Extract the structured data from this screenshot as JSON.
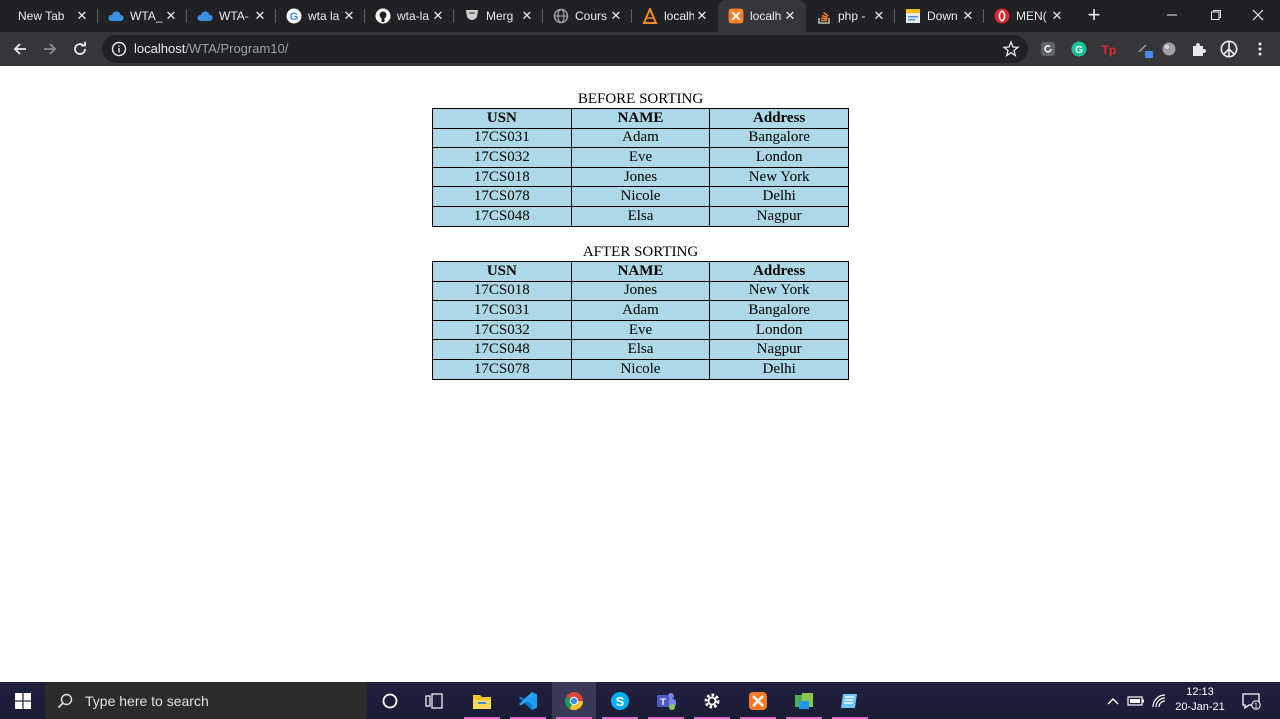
{
  "browser": {
    "tabs": [
      {
        "title": "New Tab",
        "icon": "none"
      },
      {
        "title": "WTA_",
        "icon": "onedrive-icon"
      },
      {
        "title": "WTA-",
        "icon": "onedrive-icon"
      },
      {
        "title": "wta la",
        "icon": "google-icon"
      },
      {
        "title": "wta-la",
        "icon": "github-icon"
      },
      {
        "title": "Merg",
        "icon": "merge-icon"
      },
      {
        "title": "Cours",
        "icon": "globe-icon"
      },
      {
        "title": "localh",
        "icon": "xampp-icon"
      },
      {
        "title": "localh",
        "icon": "xampp-icon",
        "active": true
      },
      {
        "title": "php -",
        "icon": "stackoverflow-icon"
      },
      {
        "title": "Down",
        "icon": "document-icon"
      },
      {
        "title": "MEN(",
        "icon": "opera-icon"
      }
    ],
    "url": {
      "host": "localhost",
      "path": "/WTA/Program10/"
    }
  },
  "page": {
    "before_caption": "BEFORE SORTING",
    "after_caption": "AFTER SORTING",
    "headers": [
      "USN",
      "NAME",
      "Address"
    ],
    "before_rows": [
      [
        "17CS031",
        "Adam",
        "Bangalore"
      ],
      [
        "17CS032",
        "Eve",
        "London"
      ],
      [
        "17CS018",
        "Jones",
        "New York"
      ],
      [
        "17CS078",
        "Nicole",
        "Delhi"
      ],
      [
        "17CS048",
        "Elsa",
        "Nagpur"
      ]
    ],
    "after_rows": [
      [
        "17CS018",
        "Jones",
        "New York"
      ],
      [
        "17CS031",
        "Adam",
        "Bangalore"
      ],
      [
        "17CS032",
        "Eve",
        "London"
      ],
      [
        "17CS048",
        "Elsa",
        "Nagpur"
      ],
      [
        "17CS078",
        "Nicole",
        "Delhi"
      ]
    ]
  },
  "taskbar": {
    "search_placeholder": "Type here to search",
    "time": "12:13",
    "date": "20-Jan-21",
    "notification_count": "1"
  },
  "colors": {
    "table_bg": "#add8e6",
    "chrome_dark": "#202124",
    "chrome_toolbar": "#35363a"
  }
}
